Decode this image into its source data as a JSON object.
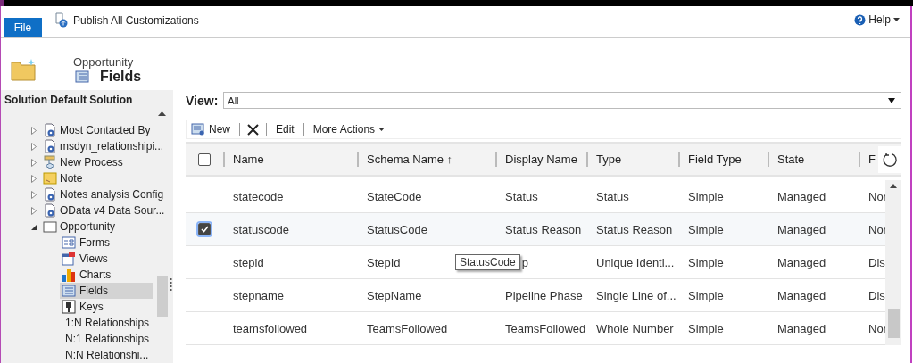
{
  "ribbon": {
    "file_tab": "File",
    "publish_button": "Publish All Customizations",
    "help_menu": "Help"
  },
  "header": {
    "entity": "Opportunity",
    "component": "Fields"
  },
  "sidebar": {
    "title": "Solution Default Solution",
    "tree": [
      {
        "label": "Most Contacted By",
        "kind": "entity",
        "expanded": false
      },
      {
        "label": "msdyn_relationshipi...",
        "kind": "entity",
        "expanded": false
      },
      {
        "label": "New Process",
        "kind": "process",
        "expanded": false
      },
      {
        "label": "Note",
        "kind": "note",
        "expanded": false
      },
      {
        "label": "Notes analysis Config",
        "kind": "entity",
        "expanded": false
      },
      {
        "label": "OData v4 Data Sour...",
        "kind": "entity",
        "expanded": false
      },
      {
        "label": "Opportunity",
        "kind": "folder",
        "expanded": true,
        "children": [
          {
            "label": "Forms",
            "kind": "form",
            "selected": false
          },
          {
            "label": "Views",
            "kind": "view",
            "selected": false
          },
          {
            "label": "Charts",
            "kind": "chart",
            "selected": false
          },
          {
            "label": "Fields",
            "kind": "field",
            "selected": true
          },
          {
            "label": "Keys",
            "kind": "key",
            "selected": false
          },
          {
            "label": "1:N Relationships",
            "kind": "rel",
            "selected": false
          },
          {
            "label": "N:1 Relationships",
            "kind": "rel",
            "selected": false
          },
          {
            "label": "N:N Relationshi...",
            "kind": "rel",
            "selected": false
          }
        ]
      }
    ]
  },
  "view": {
    "label": "View:",
    "value": "All"
  },
  "toolbar": {
    "new_button": "New",
    "edit_button": "Edit",
    "more_actions": "More Actions"
  },
  "table": {
    "all_checked": false,
    "columns": [
      {
        "label": "Name"
      },
      {
        "label": "Schema Name",
        "sort_arrow": "↑"
      },
      {
        "label": "Display Name"
      },
      {
        "label": "Type"
      },
      {
        "label": "Field Type"
      },
      {
        "label": "State"
      },
      {
        "label": "F"
      }
    ],
    "rows": [
      {
        "checked": false,
        "cells": [
          "statecode",
          "StateCode",
          "Status",
          "Status",
          "Simple",
          "Managed",
          "Nor"
        ]
      },
      {
        "checked": true,
        "cells": [
          "statuscode",
          "StatusCode",
          "Status Reason",
          "Status Reason",
          "Simple",
          "Managed",
          "Nor"
        ]
      },
      {
        "checked": false,
        "cells": [
          "stepid",
          "StepId",
          "p",
          "Unique Identi...",
          "Simple",
          "Managed",
          "Dis"
        ],
        "tooltip": "StatusCode"
      },
      {
        "checked": false,
        "cells": [
          "stepname",
          "StepName",
          "Pipeline Phase",
          "Single Line of...",
          "Simple",
          "Managed",
          "Dis"
        ]
      },
      {
        "checked": false,
        "cells": [
          "teamsfollowed",
          "TeamsFollowed",
          "TeamsFollowed",
          "Whole Number",
          "Simple",
          "Managed",
          "Nor"
        ]
      }
    ]
  }
}
